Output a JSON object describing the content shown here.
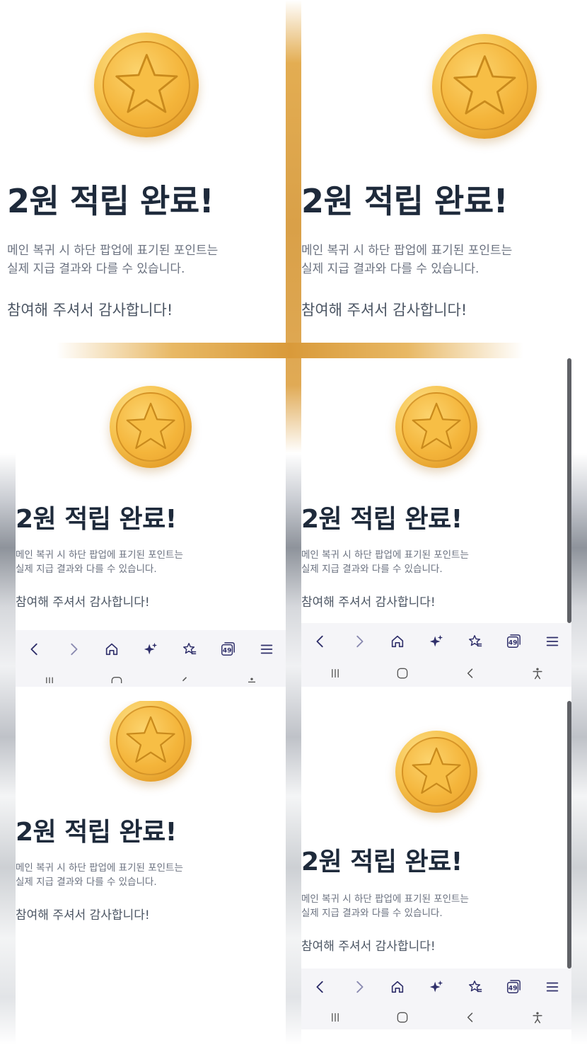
{
  "screen": {
    "title": "2원 적립 완료!",
    "description_line1": "메인 복귀 시 하단 팝업에 표기된 포인트는",
    "description_line2": "실제 지급 결과와 다를 수 있습니다.",
    "thanks": "참여해 주셔서 감사합니다!"
  },
  "browser_toolbar": {
    "tab_count": "49",
    "buttons": [
      "back",
      "forward",
      "home",
      "ai-assistant",
      "bookmarks",
      "tabs",
      "menu"
    ]
  },
  "system_nav": {
    "buttons": [
      "recent-apps",
      "home",
      "back",
      "accessibility"
    ]
  },
  "colors": {
    "title": "#1e2a3b",
    "description": "#6b7280",
    "thanks": "#4b5563",
    "coin_gold": "#f4b53b",
    "toolbar_icons": "#2f2f6a",
    "toolbar_bg": "#f5f5f8"
  },
  "icons": {
    "coin": "star-coin-icon",
    "back": "chevron-left-icon",
    "forward": "chevron-right-icon",
    "home": "home-icon",
    "ai": "sparkle-icon",
    "bookmarks": "star-list-icon",
    "tabs": "tabs-icon",
    "menu": "hamburger-icon"
  }
}
